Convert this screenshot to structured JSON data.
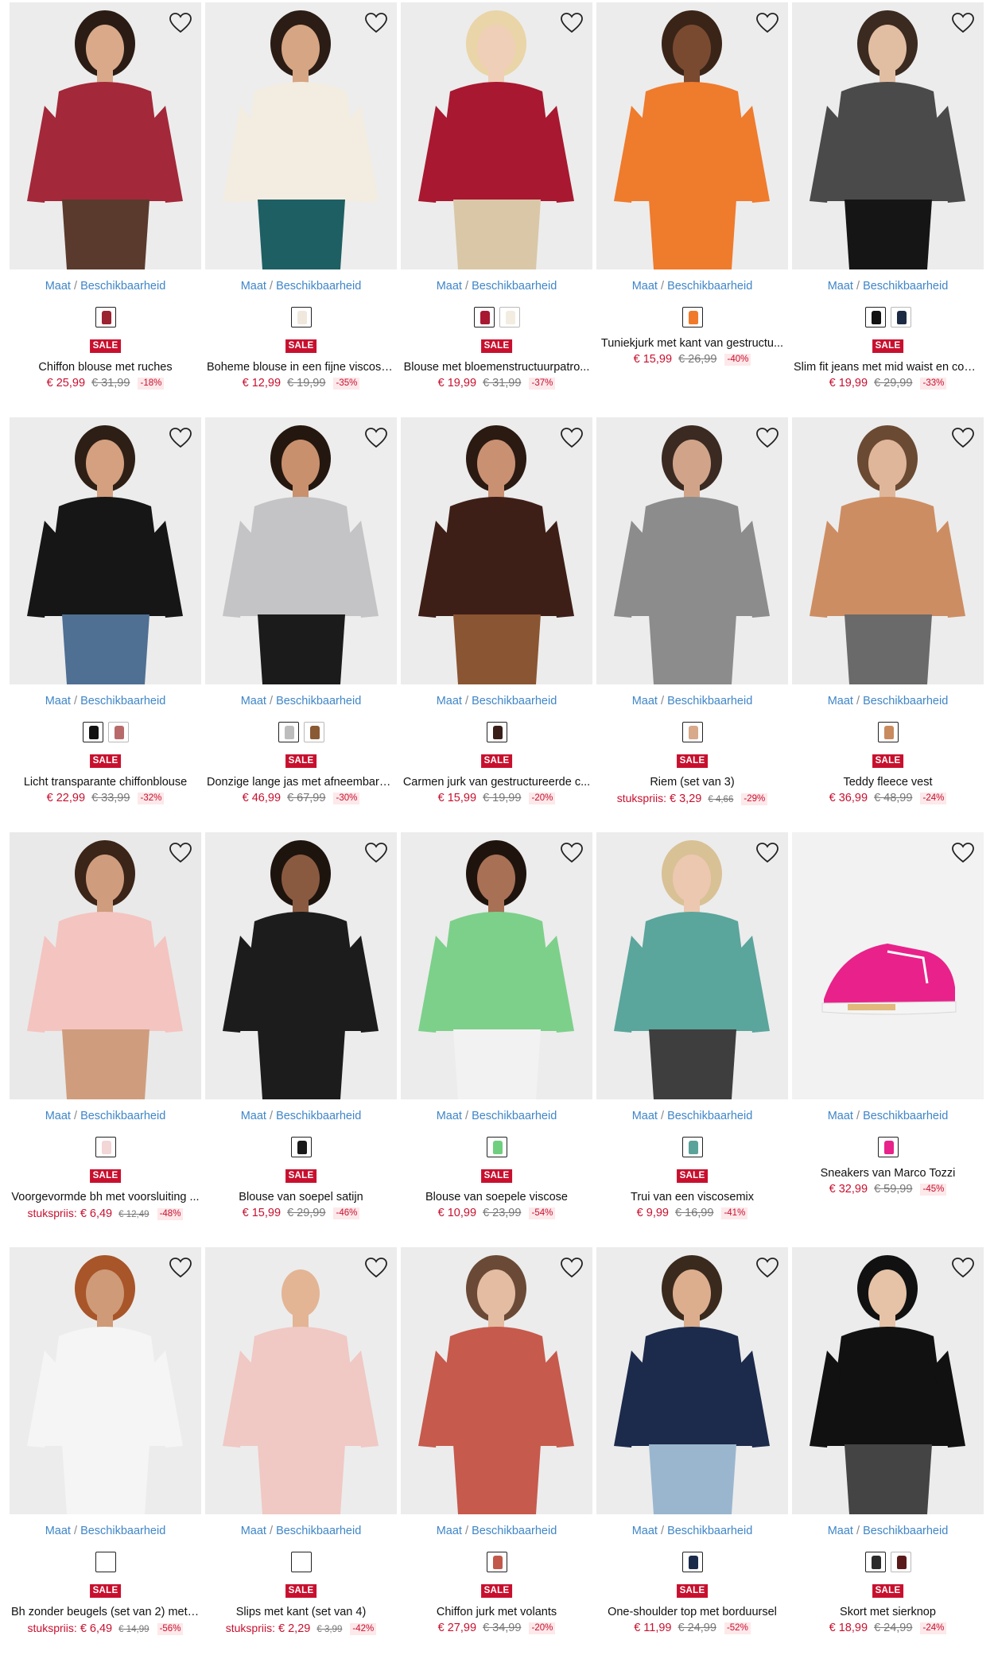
{
  "ui": {
    "size_label": "Maat",
    "separator": "/",
    "availability_label": "Beschikbaarheid",
    "sale_badge": "SALE",
    "wishlist_icon": "heart-outline-icon"
  },
  "products": [
    {
      "name": "Chiffon blouse met ruches",
      "price": "€ 25,99",
      "old_price": "€ 31,99",
      "discount": "-18%",
      "sale": true,
      "swatches": [
        "#9b2230"
      ],
      "bg": "#ececec",
      "garment": "#a3283a",
      "lower": "#5a3a2c",
      "skin": "#d9a98a",
      "hair": "#2a1c14"
    },
    {
      "name": "Boheme blouse in een fijne viscose...",
      "price": "€ 12,99",
      "old_price": "€ 19,99",
      "discount": "-35%",
      "sale": true,
      "swatches": [
        "#f0e8dc"
      ],
      "bg": "#ededed",
      "garment": "#f3ece0",
      "lower": "#1e5f63",
      "skin": "#d6a583",
      "hair": "#2b1d15"
    },
    {
      "name": "Blouse met bloemenstructuurpatro...",
      "price": "€ 19,99",
      "old_price": "€ 31,99",
      "discount": "-37%",
      "sale": true,
      "swatches": [
        "#a81830",
        "#f3ece0"
      ],
      "bg": "#ececec",
      "garment": "#a81830",
      "lower": "#d9c7a7",
      "skin": "#efcfb8",
      "hair": "#e9d5a8"
    },
    {
      "name": "Tuniekjurk met kant van gestructu...",
      "price": "€ 15,99",
      "old_price": "€ 26,99",
      "discount": "-40%",
      "sale": false,
      "swatches": [
        "#f07a2a"
      ],
      "bg": "#ececec",
      "garment": "#ef7b2d",
      "lower": "#ef7b2d",
      "skin": "#7a4a30",
      "hair": "#3a2418"
    },
    {
      "name": "Slim fit jeans met mid waist en com...",
      "price": "€ 19,99",
      "old_price": "€ 29,99",
      "discount": "-33%",
      "sale": true,
      "swatches": [
        "#111111",
        "#1c2a44"
      ],
      "bg": "#ececec",
      "garment": "#4a4a4a",
      "lower": "#151515",
      "skin": "#e1bda2",
      "hair": "#3b2a20"
    },
    {
      "name": "Licht transparante chiffonblouse",
      "price": "€ 22,99",
      "old_price": "€ 33,99",
      "discount": "-32%",
      "sale": true,
      "swatches": [
        "#111111",
        "#b86a6a"
      ],
      "bg": "#ececec",
      "garment": "#161616",
      "lower": "#4f6f93",
      "skin": "#d4a07f",
      "hair": "#2e1f16"
    },
    {
      "name": "Donzige lange jas met afneembare ...",
      "price": "€ 46,99",
      "old_price": "€ 67,99",
      "discount": "-30%",
      "sale": true,
      "swatches": [
        "#bdbdbd",
        "#8a5a34"
      ],
      "bg": "#ededed",
      "garment": "#c4c4c6",
      "lower": "#1b1b1b",
      "skin": "#c9906e",
      "hair": "#24170f"
    },
    {
      "name": "Carmen jurk van gestructureerde c...",
      "price": "€ 15,99",
      "old_price": "€ 19,99",
      "discount": "-20%",
      "sale": true,
      "swatches": [
        "#3a1e18"
      ],
      "bg": "#ececec",
      "garment": "#3e1f17",
      "lower": "#8a5532",
      "skin": "#c99072",
      "hair": "#2a1a12"
    },
    {
      "name": "Riem (set van 3)",
      "price_prefix": "stukspriis:",
      "price": "€ 3,29",
      "old_price": "€ 4,66",
      "discount": "-29%",
      "sale": true,
      "unit": true,
      "swatches": [
        "#d8a98a"
      ],
      "bg": "#ececec",
      "garment": "#8c8c8c",
      "lower": "#8c8c8c",
      "skin": "#d1a48a",
      "hair": "#3a2a22"
    },
    {
      "name": "Teddy fleece vest",
      "price": "€ 36,99",
      "old_price": "€ 48,99",
      "discount": "-24%",
      "sale": true,
      "swatches": [
        "#c98a5e"
      ],
      "bg": "#ececec",
      "garment": "#cd8d62",
      "lower": "#6a6a6a",
      "skin": "#e0b69a",
      "hair": "#6b4a33"
    },
    {
      "name": "Voorgevormde bh met voorsluiting ...",
      "price_prefix": "stukspriis:",
      "price": "€ 6,49",
      "old_price": "€ 12,49",
      "discount": "-48%",
      "sale": true,
      "unit": true,
      "swatches": [
        "#f3d6d6"
      ],
      "bg": "#e9e9e9",
      "garment": "#f4c4c0",
      "lower": "#cf9d7d",
      "skin": "#cf9d7d",
      "hair": "#3b2418"
    },
    {
      "name": "Blouse van soepel satijn",
      "price": "€ 15,99",
      "old_price": "€ 29,99",
      "discount": "-46%",
      "sale": true,
      "swatches": [
        "#1a1a1a"
      ],
      "bg": "#ececec",
      "garment": "#1c1c1c",
      "lower": "#1c1c1c",
      "skin": "#8a5a40",
      "hair": "#1e140e"
    },
    {
      "name": "Blouse van soepele viscose",
      "price": "€ 10,99",
      "old_price": "€ 23,99",
      "discount": "-54%",
      "sale": true,
      "swatches": [
        "#6fcf7e"
      ],
      "bg": "#ececec",
      "garment": "#7dd08a",
      "lower": "#f2f2f2",
      "skin": "#a87055",
      "hair": "#1f140d"
    },
    {
      "name": "Trui van een viscosemix",
      "price": "€ 9,99",
      "old_price": "€ 16,99",
      "discount": "-41%",
      "sale": true,
      "swatches": [
        "#5aa39a"
      ],
      "bg": "#ececec",
      "garment": "#5aa59c",
      "lower": "#3e3e3e",
      "skin": "#ecc8b0",
      "hair": "#d9c196"
    },
    {
      "name": "Sneakers van Marco Tozzi",
      "price": "€ 32,99",
      "old_price": "€ 59,99",
      "discount": "-45%",
      "sale": false,
      "swatches": [
        "#e8228a"
      ],
      "bg": "#f2f2f2",
      "garment": "#e8228a",
      "lower": "#e8228a",
      "skin": "#f2f2f2",
      "hair": "#f2f2f2",
      "shoe": true
    },
    {
      "name": "Bh zonder beugels (set van 2) met g...",
      "price_prefix": "stukspriis:",
      "price": "€ 6,49",
      "old_price": "€ 14,99",
      "discount": "-56%",
      "sale": true,
      "unit": true,
      "swatches": [
        "#ffffff"
      ],
      "bg": "#ececec",
      "garment": "#f5f5f5",
      "lower": "#f5f5f5",
      "skin": "#cf9a78",
      "hair": "#a8552a"
    },
    {
      "name": "Slips met kant (set van 4)",
      "price_prefix": "stukspriis:",
      "price": "€ 2,29",
      "old_price": "€ 3,99",
      "discount": "-42%",
      "sale": true,
      "unit": true,
      "swatches": [
        "#ffffff"
      ],
      "bg": "#ececec",
      "garment": "#f0c8c4",
      "lower": "#f0c8c4",
      "skin": "#e3b595",
      "hair": "#ececec"
    },
    {
      "name": "Chiffon jurk met volants",
      "price": "€ 27,99",
      "old_price": "€ 34,99",
      "discount": "-20%",
      "sale": true,
      "swatches": [
        "#c2584a"
      ],
      "bg": "#ececec",
      "garment": "#c65a4c",
      "lower": "#c65a4c",
      "skin": "#e3bca2",
      "hair": "#6a4a36"
    },
    {
      "name": "One-shoulder top met borduursel",
      "price": "€ 11,99",
      "old_price": "€ 24,99",
      "discount": "-52%",
      "sale": true,
      "swatches": [
        "#1a2a4a"
      ],
      "bg": "#ececec",
      "garment": "#1c2a4c",
      "lower": "#9ab6cf",
      "skin": "#dcae8e",
      "hair": "#3a2a1e"
    },
    {
      "name": "Skort met sierknop",
      "price": "€ 18,99",
      "old_price": "€ 24,99",
      "discount": "-24%",
      "sale": true,
      "swatches": [
        "#2a2a2a",
        "#5a1a1a"
      ],
      "bg": "#ececec",
      "garment": "#111111",
      "lower": "#444444",
      "skin": "#e6c2a6",
      "hair": "#111111"
    }
  ]
}
